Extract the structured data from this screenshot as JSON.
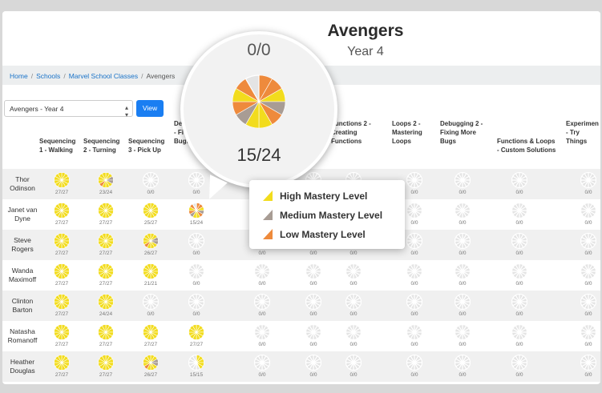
{
  "header": {
    "title": "Avengers",
    "subtitle": "Year 4"
  },
  "breadcrumb": [
    {
      "label": "Home",
      "link": true
    },
    {
      "label": "Schools",
      "link": true
    },
    {
      "label": "Marvel School Classes",
      "link": true
    },
    {
      "label": "Avengers",
      "link": false
    }
  ],
  "class_select": {
    "value": "Avengers - Year 4"
  },
  "view_button": {
    "label": "View"
  },
  "columns": [
    "Sequencing\n1 - Walking",
    "Sequencing\n2 - Turning",
    "Sequencing\n3 - Pick Up",
    "De\n- Fi\nBugs",
    "",
    "",
    "Functions 2 -\nCreating\nFunctions",
    "Loops 2 -\nMastering\nLoops",
    "Debugging 2 -\nFixing More\nBugs",
    "Functions & Loops\n- Custom Solutions",
    "Experimen\n- Try\nThings"
  ],
  "students": [
    {
      "name": "Thor\nOdinson",
      "scores": [
        "27/27",
        "23/24",
        "0/0",
        "0/0",
        "0/0",
        "0/0",
        "0/0",
        "0/0",
        "0/0",
        "0/0",
        "0/0"
      ],
      "levels": [
        "high",
        "mixed-light",
        "none",
        "none",
        "none",
        "none",
        "none",
        "none",
        "none",
        "none",
        "none"
      ]
    },
    {
      "name": "Janet van\nDyne",
      "scores": [
        "27/27",
        "27/27",
        "25/27",
        "15/24",
        "0/0",
        "0/0",
        "0/0",
        "0/0",
        "0/0",
        "0/0",
        "0/0"
      ],
      "levels": [
        "high",
        "high",
        "high",
        "mixed-heavy",
        "none",
        "none",
        "none",
        "none",
        "none",
        "none",
        "none"
      ]
    },
    {
      "name": "Steve\nRogers",
      "scores": [
        "27/27",
        "27/27",
        "26/27",
        "0/0",
        "0/0",
        "0/0",
        "0/0",
        "0/0",
        "0/0",
        "0/0",
        "0/0"
      ],
      "levels": [
        "high",
        "high",
        "mixed-light",
        "none",
        "none",
        "none",
        "none",
        "none",
        "none",
        "none",
        "none"
      ]
    },
    {
      "name": "Wanda\nMaximoff",
      "scores": [
        "27/27",
        "27/27",
        "21/21",
        "0/0",
        "0/0",
        "0/0",
        "0/0",
        "0/0",
        "0/0",
        "0/0",
        "0/0"
      ],
      "levels": [
        "high",
        "high",
        "high",
        "none",
        "none",
        "none",
        "none",
        "none",
        "none",
        "none",
        "none"
      ]
    },
    {
      "name": "Clinton\nBarton",
      "scores": [
        "27/27",
        "24/24",
        "0/0",
        "0/0",
        "0/0",
        "0/0",
        "0/0",
        "0/0",
        "0/0",
        "0/0",
        "0/0"
      ],
      "levels": [
        "high",
        "high",
        "none",
        "none",
        "none",
        "none",
        "none",
        "none",
        "none",
        "none",
        "none"
      ]
    },
    {
      "name": "Natasha\nRomanoff",
      "scores": [
        "27/27",
        "27/27",
        "27/27",
        "27/27",
        "0/0",
        "0/0",
        "0/0",
        "0/0",
        "0/0",
        "0/0",
        "0/0"
      ],
      "levels": [
        "high",
        "high",
        "high",
        "high",
        "none",
        "none",
        "none",
        "none",
        "none",
        "none",
        "none"
      ]
    },
    {
      "name": "Heather\nDouglas",
      "scores": [
        "27/27",
        "27/27",
        "26/27",
        "15/15",
        "0/0",
        "0/0",
        "0/0",
        "0/0",
        "0/0",
        "0/0",
        "0/0"
      ],
      "levels": [
        "high",
        "high",
        "mixed-light",
        "partial-high",
        "none",
        "none",
        "none",
        "none",
        "none",
        "none",
        "none"
      ]
    }
  ],
  "zoom": {
    "top_score": "0/0",
    "score": "15/24"
  },
  "legend": [
    {
      "label": "High Mastery Level",
      "color": "#f2dc1d"
    },
    {
      "label": "Medium Mastery Level",
      "color": "#a89c94"
    },
    {
      "label": "Low Mastery Level",
      "color": "#ee8a3c"
    }
  ],
  "colors": {
    "high": "#f2dc1d",
    "medium": "#a89c94",
    "low": "#ee8a3c",
    "empty": "#e4e4e4",
    "accent": "#1a7ef2"
  }
}
